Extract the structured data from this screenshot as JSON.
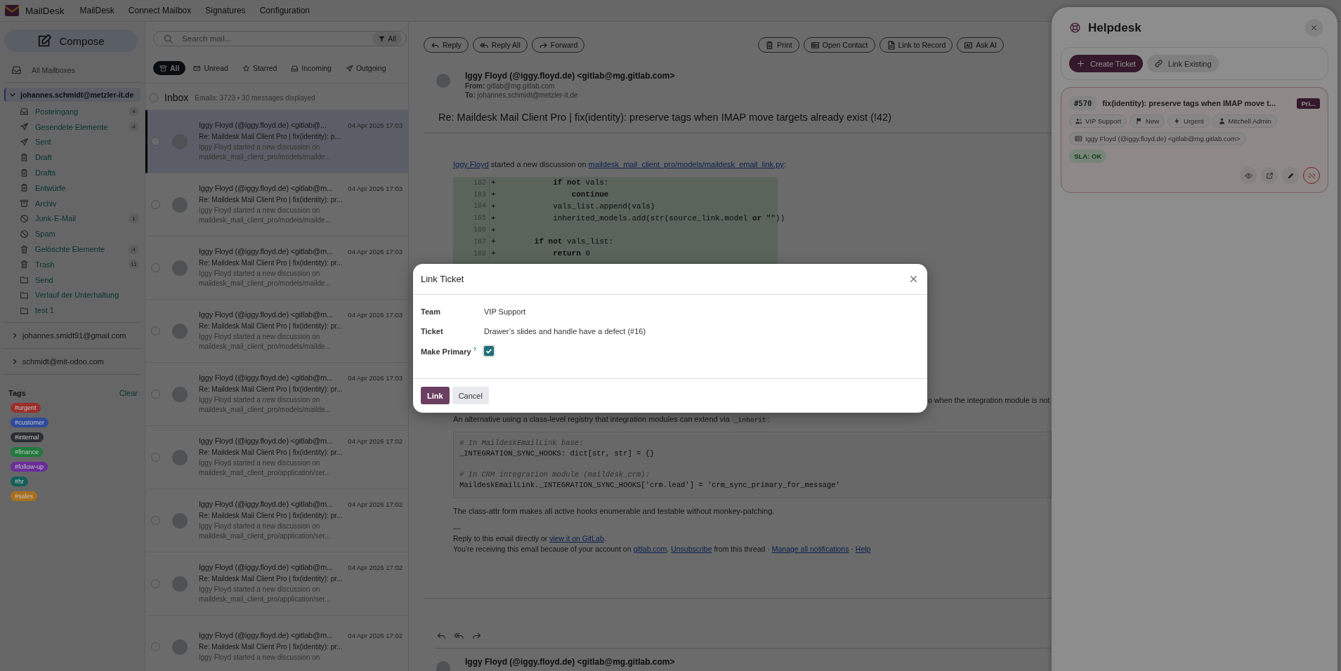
{
  "top_bar": {
    "brand": "MailDesk",
    "nav": [
      "MailDesk",
      "Connect Mailbox",
      "Signatures",
      "Configuration"
    ]
  },
  "sidebar": {
    "compose": "Compose",
    "all_mailboxes": "All Mailboxes",
    "accounts": [
      {
        "email": "johannes.schmidt@metzler-it.de",
        "expanded": true,
        "selected": true,
        "folders": [
          {
            "name": "Posteingang",
            "kind": "inbox",
            "count": "4"
          },
          {
            "name": "Gesendete Elemente",
            "kind": "sent",
            "count": "4"
          },
          {
            "name": "Sent",
            "kind": "sent"
          },
          {
            "name": "Draft",
            "kind": "drafts"
          },
          {
            "name": "Drafts",
            "kind": "drafts"
          },
          {
            "name": "Entwürfe",
            "kind": "drafts"
          },
          {
            "name": "Archiv",
            "kind": "archive"
          },
          {
            "name": "Junk-E-Mail",
            "kind": "junk",
            "count": "1"
          },
          {
            "name": "Spam",
            "kind": "junk"
          },
          {
            "name": "Gelöschte Elemente",
            "kind": "trash",
            "count": "4"
          },
          {
            "name": "Trash",
            "kind": "trash",
            "count": "11"
          },
          {
            "name": "Send",
            "kind": "folder"
          },
          {
            "name": "Verlauf der Unterhaltung",
            "kind": "folder"
          },
          {
            "name": "test 1",
            "kind": "folder"
          }
        ]
      },
      {
        "email": "johannes.smidt91@gmail.com",
        "expanded": false,
        "selected": false
      },
      {
        "email": "schmidt@mit-odoo.com",
        "expanded": false,
        "selected": false
      }
    ],
    "tags_title": "Tags",
    "clear": "Clear",
    "tags": [
      {
        "label": "#urgent",
        "color": "#9a2f2b"
      },
      {
        "label": "#customer",
        "color": "#2f4a9a"
      },
      {
        "label": "#internal",
        "color": "#2b2e33"
      },
      {
        "label": "#finance",
        "color": "#1f7a3a"
      },
      {
        "label": "#follow-up",
        "color": "#6a2d9a"
      },
      {
        "label": "#hr",
        "color": "#125f57"
      },
      {
        "label": "#sales",
        "color": "#a8701c"
      }
    ]
  },
  "mail_list": {
    "search": {
      "placeholder": "Search mail...",
      "filter_button": "All"
    },
    "filters": [
      {
        "label": "All",
        "kind": "all",
        "selected": true
      },
      {
        "label": "Unread",
        "kind": "unread",
        "selected": false
      },
      {
        "label": "Starred",
        "kind": "starred",
        "selected": false
      },
      {
        "label": "Incoming",
        "kind": "incoming",
        "selected": false
      },
      {
        "label": "Outgoing",
        "kind": "outgoing",
        "selected": false
      }
    ],
    "folder": {
      "title": "Inbox",
      "summary": "Emails: 3723 • 30 messages displayed",
      "checked": false
    },
    "rows": [
      {
        "sender": "Iggy Floyd (@iggy.floyd.de) <gitlab@...",
        "date": "04 Apr 2026 17:03",
        "subject": "Re: Maildesk Mail Client Pro | fix(identity): p...",
        "preview": [
          "Iggy Floyd started a new discussion on",
          "maildesk_mail_client_pro/models/mailde..."
        ],
        "selected": true,
        "checked": false
      },
      {
        "sender": "Iggy Floyd (@iggy.floyd.de) <gitlab@m...",
        "date": "04 Apr 2026 17:03",
        "subject": "Re: Maildesk Mail Client Pro | fix(identity): pr...",
        "preview": [
          "Iggy Floyd started a new discussion on",
          "maildesk_mail_client_pro/models/mailde..."
        ],
        "selected": false,
        "checked": false
      },
      {
        "sender": "Iggy Floyd (@iggy.floyd.de) <gitlab@m...",
        "date": "04 Apr 2026 17:03",
        "subject": "Re: Maildesk Mail Client Pro | fix(identity): pr...",
        "preview": [
          "Iggy Floyd started a new discussion on",
          "maildesk_mail_client_pro/models/mailde..."
        ],
        "selected": false,
        "checked": false
      },
      {
        "sender": "Iggy Floyd (@iggy.floyd.de) <gitlab@m...",
        "date": "04 Apr 2026 17:03",
        "subject": "Re: Maildesk Mail Client Pro | fix(identity): pr...",
        "preview": [
          "Iggy Floyd started a new discussion on",
          "maildesk_mail_client_pro/models/mailde..."
        ],
        "selected": false,
        "checked": false
      },
      {
        "sender": "Iggy Floyd (@iggy.floyd.de) <gitlab@m...",
        "date": "04 Apr 2026 17:03",
        "subject": "Re: Maildesk Mail Client Pro | fix(identity): pr...",
        "preview": [
          "Iggy Floyd started a new discussion on",
          "maildesk_mail_client_pro/models/mailde..."
        ],
        "selected": false,
        "checked": false
      },
      {
        "sender": "Iggy Floyd (@iggy.floyd.de) <gitlab@m...",
        "date": "04 Apr 2026 17:02",
        "subject": "Re: Maildesk Mail Client Pro | fix(identity): pr...",
        "preview": [
          "Iggy Floyd started a new discussion on",
          "maildesk_mail_client_pro/application/ser..."
        ],
        "selected": false,
        "checked": false
      },
      {
        "sender": "Iggy Floyd (@iggy.floyd.de) <gitlab@m...",
        "date": "04 Apr 2026 17:02",
        "subject": "Re: Maildesk Mail Client Pro | fix(identity): pr...",
        "preview": [
          "Iggy Floyd started a new discussion on",
          "maildesk_mail_client_pro/application/ser..."
        ],
        "selected": false,
        "checked": false
      },
      {
        "sender": "Iggy Floyd (@iggy.floyd.de) <gitlab@m...",
        "date": "04 Apr 2026 17:02",
        "subject": "Re: Maildesk Mail Client Pro | fix(identity): pr...",
        "preview": [
          "Iggy Floyd started a new discussion on",
          "maildesk_mail_client_pro/application/ser..."
        ],
        "selected": false,
        "checked": false
      },
      {
        "sender": "Iggy Floyd (@iggy.floyd.de) <gitlab@m...",
        "date": "04 Apr 2026 17:02",
        "subject": "Re: Maildesk Mail Client Pro | fix(identity): pr...",
        "preview": [
          "Iggy Floyd started a new discussion on"
        ],
        "selected": false,
        "checked": false
      }
    ]
  },
  "email": {
    "actions_left": [
      {
        "label": "Reply",
        "kind": "reply"
      },
      {
        "label": "Reply All",
        "kind": "reply_all"
      },
      {
        "label": "Forward",
        "kind": "forward"
      }
    ],
    "actions_right": [
      {
        "label": "Print",
        "kind": "print"
      },
      {
        "label": "Open Contact",
        "kind": "contact"
      },
      {
        "label": "Link to Record",
        "kind": "record"
      },
      {
        "label": "Ask AI",
        "kind": "ai"
      }
    ],
    "sender": "Iggy Floyd (@iggy.floyd.de) <gitlab@mg.gitlab.com>",
    "from_label": "From:",
    "from": "gitlab@mg.gitlab.com",
    "to_label": "To:",
    "to": "johannes.schmidt@metzler-it.de",
    "subject": "Re: Maildesk Mail Client Pro | fix(identity): preserve tags when IMAP move targets already exist (!42)",
    "body": [
      {
        "kind": "paragraph",
        "segments": [
          {
            "kind": "link",
            "text": "Iggy Floyd"
          },
          {
            "kind": "text",
            "text": " started a new discussion on "
          },
          {
            "kind": "link",
            "text": "maildesk_mail_client_pro/models/maildesk_email_link.py"
          },
          {
            "kind": "text",
            "text": ":"
          }
        ]
      },
      {
        "kind": "diff",
        "lines": [
          {
            "number": "182",
            "sign": "+",
            "code": "            **if not** vals:"
          },
          {
            "number": "183",
            "sign": "+",
            "code": "                **continue**"
          },
          {
            "number": "184",
            "sign": "+",
            "code": "            vals_list.append(vals)"
          },
          {
            "number": "185",
            "sign": "+",
            "code": "            inherited_models.add(str(source_link.model **or** \"\"))"
          },
          {
            "number": "186",
            "sign": "+"
          },
          {
            "number": "187",
            "sign": "+",
            "code": "        **if not** vals_list:"
          },
          {
            "number": "188",
            "sign": "+",
            "code": "            **return** 0"
          }
        ]
      },
      {
        "kind": "tail",
        "segments": [
          {
            "kind": "text",
            "text": "o when the integration module is not"
          }
        ]
      },
      {
        "kind": "paragraph",
        "segments": [
          {
            "kind": "text",
            "text": "An alternative using a class-level registry that integration modules can extend via "
          },
          {
            "kind": "code",
            "text": "_inherit"
          },
          {
            "kind": "text",
            "text": ":"
          }
        ]
      },
      {
        "kind": "code",
        "lines": [
          {
            "kind": "comment",
            "text": "# In MaildeskEmailLink base:"
          },
          {
            "kind": "code",
            "text": "_INTEGRATION_SYNC_HOOKS: dict[str, str] = {}"
          },
          {
            "kind": "blank"
          },
          {
            "kind": "comment",
            "text": "# In CRM integration module (maildesk_crm):"
          },
          {
            "kind": "code",
            "text": "MaildeskEmailLink._INTEGRATION_SYNC_HOOKS['crm.lead'] = 'crm_sync_primary_for_message'"
          }
        ]
      },
      {
        "kind": "paragraph",
        "segments": [
          {
            "kind": "text",
            "text": "The class-attr form makes all active hooks enumerable and testable without monkey-patching."
          }
        ]
      },
      {
        "kind": "signature",
        "segments": [
          {
            "kind": "text",
            "text": "—"
          }
        ]
      },
      {
        "kind": "signature",
        "segments": [
          {
            "kind": "text",
            "text": "Reply to this email directly or "
          },
          {
            "kind": "link",
            "text": "view it on GitLab"
          },
          {
            "kind": "text",
            "text": "."
          }
        ]
      },
      {
        "kind": "signature",
        "segments": [
          {
            "kind": "text",
            "text": "You’re receiving this email because of your account on "
          },
          {
            "kind": "link",
            "text": "gitlab.com"
          },
          {
            "kind": "text",
            "text": ". "
          },
          {
            "kind": "link",
            "text": "Unsubscribe"
          },
          {
            "kind": "text",
            "text": " from this thread · "
          },
          {
            "kind": "link",
            "text": "Manage all notifications"
          },
          {
            "kind": "text",
            "text": " · "
          },
          {
            "kind": "link",
            "text": "Help"
          }
        ]
      }
    ],
    "reply_bar": [
      {
        "kind": "reply"
      },
      {
        "kind": "reply_all"
      },
      {
        "kind": "forward"
      }
    ],
    "next_sender": "Iggy Floyd (@iggy.floyd.de) <gitlab@mg.gitlab.com>"
  },
  "helpdesk": {
    "title": "Helpdesk",
    "actions": [
      {
        "label": "Create Ticket",
        "kind": "create"
      },
      {
        "label": "Link Existing",
        "kind": "link"
      }
    ],
    "ticket": {
      "number": "#570",
      "title": "fix(identity): preserve tags when IMAP move t...",
      "badge": "Pri...",
      "chips": [
        {
          "label": "VIP Support",
          "kind": "team"
        },
        {
          "label": "New",
          "kind": "stage"
        },
        {
          "label": "Urgent",
          "kind": "priority"
        },
        {
          "label": "Mitchell Admin",
          "kind": "user"
        }
      ],
      "contact": "Iggy Floyd (@iggy.floyd.de) <gitlab@mg.gitlab.com>",
      "sla": "SLA: OK",
      "tools": [
        {
          "kind": "view"
        },
        {
          "kind": "open"
        },
        {
          "kind": "edit"
        },
        {
          "kind": "unlink"
        }
      ]
    }
  },
  "dialog": {
    "title": "Link Ticket",
    "fields": [
      {
        "label": "Team",
        "kind": "text",
        "value": "VIP Support"
      },
      {
        "label": "Ticket",
        "kind": "text",
        "value": "Drawer’s slides and handle have a defect (#16)"
      },
      {
        "label": "Make Primary",
        "kind": "checkbox",
        "help": "?",
        "checked": true
      }
    ],
    "buttons": [
      {
        "label": "Link",
        "kind": "primary"
      },
      {
        "label": "Cancel",
        "kind": "secondary"
      }
    ]
  }
}
